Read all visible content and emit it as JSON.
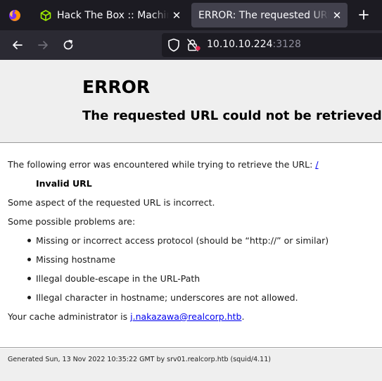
{
  "browser": {
    "tabs": [
      {
        "title": "Hack The Box :: Machines",
        "active": false,
        "icon": "htb-cube-icon",
        "icon_color": "#9fef00"
      },
      {
        "title": "ERROR: The requested URL could not be retrieved",
        "active": true,
        "icon": null
      }
    ],
    "url": {
      "host": "10.10.10.224",
      "port": ":3128"
    },
    "colors": {
      "tabbar": "#1c1b22",
      "toolbar": "#2b2a33",
      "active_tab": "#42414d",
      "text": "#fbfbfe"
    }
  },
  "page": {
    "title": "ERROR",
    "subtitle": "The requested URL could not be retrieved",
    "intro_text": "The following error was encountered while trying to retrieve the URL: ",
    "intro_link": "/",
    "error_name": "Invalid URL",
    "error_desc": "Some aspect of the requested URL is incorrect.",
    "problems_heading": "Some possible problems are:",
    "problems": [
      "Missing or incorrect access protocol (should be “http://” or similar)",
      "Missing hostname",
      "Illegal double-escape in the URL-Path",
      "Illegal character in hostname; underscores are not allowed."
    ],
    "admin_text": "Your cache administrator is ",
    "admin_email": "j.nakazawa@realcorp.htb",
    "admin_suffix": ".",
    "footer": "Generated Sun, 13 Nov 2022 10:35:22 GMT by srv01.realcorp.htb (squid/4.11)"
  }
}
